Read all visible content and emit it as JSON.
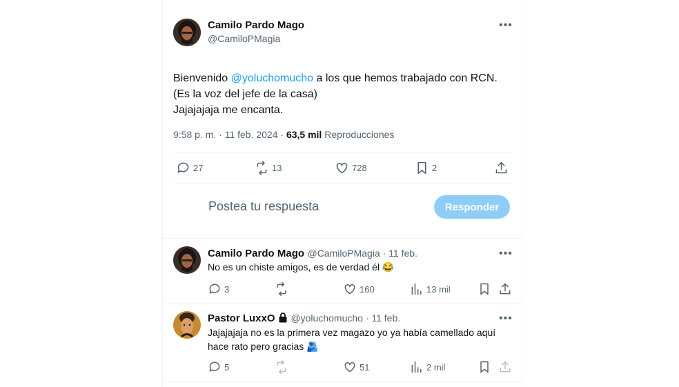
{
  "main_tweet": {
    "author_name": "Camilo Pardo Mago",
    "author_handle": "@CamiloPMagia",
    "text_before": "Bienvenido ",
    "mention": "@yoluchomucho",
    "text_after": " a los que hemos trabajado con RCN.\n(Es la voz del jefe de la casa)\nJajajajaja me encanta.",
    "time": "9:58 p. m. · 11 feb. 2024 · ",
    "views": "63,5 mil",
    "views_label": " Reproducciones",
    "replies": "27",
    "retweets": "13",
    "likes": "728",
    "bookmarks": "2"
  },
  "composer": {
    "placeholder": "Postea tu respuesta",
    "button": "Responder"
  },
  "replies": [
    {
      "author_name": "Camilo Pardo Mago",
      "author_handle": "@CamiloPMagia · 11 feb.",
      "text": "No es un chiste amigos, es de verdad él 😂",
      "replies": "3",
      "retweets": "",
      "likes": "160",
      "views": "13 mil"
    },
    {
      "author_name": "Pastor LuxxO",
      "author_handle": "@yoluchomucho · 11 feb.",
      "text": "Jajajajaja no es la primera vez magazo  yo ya había camellado aquí hace rato  pero gracias 🫂",
      "replies": "5",
      "retweets": "",
      "likes": "51",
      "views": "2 mil"
    }
  ],
  "icons": {
    "more": "more-icon",
    "reply": "reply-icon",
    "retweet": "retweet-icon",
    "like": "heart-icon",
    "bookmark": "bookmark-icon",
    "share": "share-icon",
    "views": "views-icon",
    "lock": "lock-icon"
  }
}
